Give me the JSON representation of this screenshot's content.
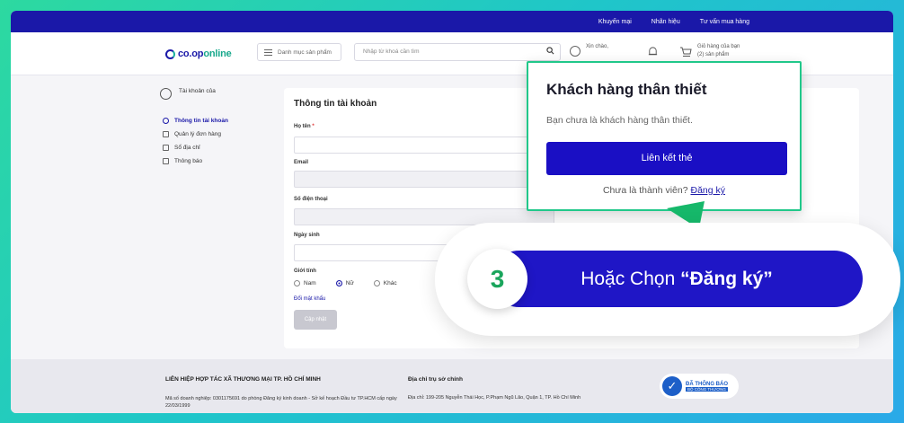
{
  "topbar": {
    "links": [
      "Khuyến mại",
      "Nhãn hiệu",
      "Tư vấn mua hàng"
    ]
  },
  "header": {
    "logo_text_a": "co.op",
    "logo_text_b": "online",
    "category_button": "Danh mục sản phẩm",
    "search_placeholder": "Nhập từ khoá cần tìm",
    "greeting": "Xin chào,",
    "cart_label_1": "Giỏ hàng của bạn",
    "cart_label_2": "(2) sản phẩm"
  },
  "sidebar": {
    "account": "Tài khoản của",
    "items": [
      {
        "label": "Thông tin tài khoản",
        "icon": "user-circle-icon"
      },
      {
        "label": "Quản lý đơn hàng",
        "icon": "orders-icon"
      },
      {
        "label": "Sổ địa chỉ",
        "icon": "address-icon"
      },
      {
        "label": "Thông báo",
        "icon": "bell-icon"
      }
    ]
  },
  "form": {
    "title": "Thông tin tài khoản",
    "name_label": "Họ tên",
    "required_mark": "*",
    "email_label": "Email",
    "phone_label": "Số điện thoại",
    "dob_label": "Ngày sinh",
    "gender_label": "Giới tính",
    "genders": [
      "Nam",
      "Nữ",
      "Khác"
    ],
    "selected_gender": "Nữ",
    "change_password": "Đổi mật khẩu",
    "save": "Cập nhật"
  },
  "footer": {
    "company": "LIÊN HIỆP HỢP TÁC XÃ THƯƠNG MẠI TP. HỒ CHÍ MINH",
    "license": "Mã số doanh nghiệp: 0301175691 do phòng Đăng ký kinh doanh - Sở kế hoạch Đầu tư TP.HCM cấp ngày 22/03/1999",
    "address_title": "Địa chỉ trụ sở chính",
    "address": "Địa chỉ: 199-205 Nguyễn Thái Học, P.Phạm Ngũ Lão, Quận 1, TP. Hồ Chí Minh",
    "badge_1": "ĐÃ THÔNG BÁO",
    "badge_2": "BỘ CÔNG THƯƠNG"
  },
  "popup": {
    "title": "Khách hàng thân thiết",
    "subtitle": "Bạn chưa là khách hàng thân thiết.",
    "link_button": "Liên kết thẻ",
    "register_prompt": "Chưa là thành viên?",
    "register_link": "Đăng ký"
  },
  "callout": {
    "step": "3",
    "text_prefix": "Hoặc Chọn ",
    "text_bold": "“Đăng ký”"
  },
  "colors": {
    "brand": "#1a18a8",
    "accent_green": "#21c88a",
    "callout_blue": "#1f16c6"
  }
}
